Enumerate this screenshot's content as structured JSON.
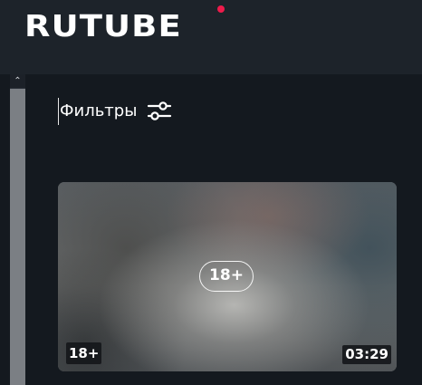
{
  "header": {
    "logo_text": "RUTUBE",
    "logo_dot_color": "#ee1b4b"
  },
  "scrollbar": {
    "up_arrow_icon": "chevron-up-icon"
  },
  "filters": {
    "label": "Фильтры",
    "icon": "sliders-icon"
  },
  "video": {
    "age_rating_center": "18+",
    "age_badge": "18+",
    "duration": "03:29"
  }
}
